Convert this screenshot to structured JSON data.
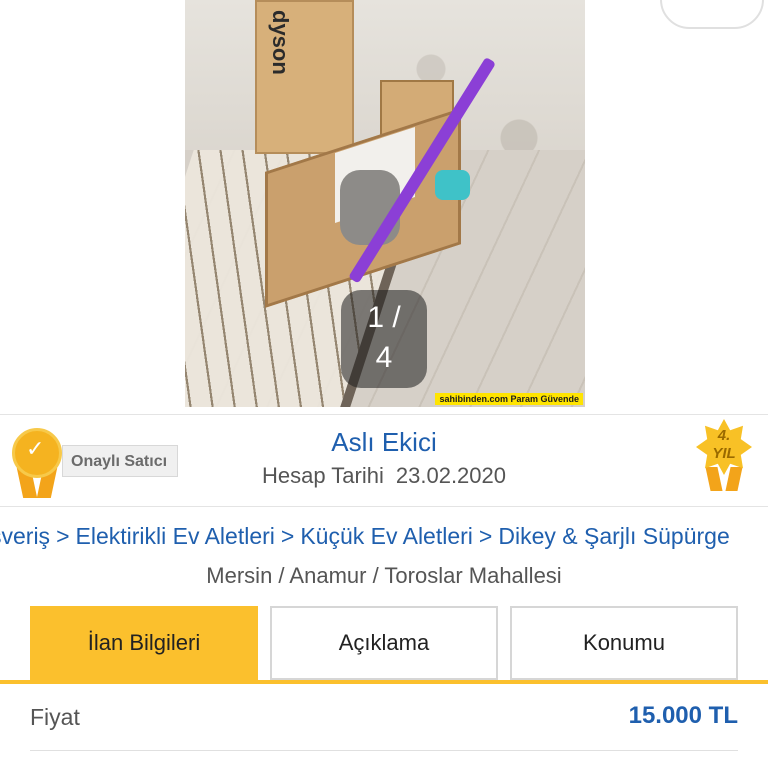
{
  "gallery": {
    "watermark": "sahibinden.com Param Güvende",
    "box_brand": "dyson",
    "counter_current": "1 /",
    "counter_total": "4"
  },
  "seller": {
    "name": "Aslı Ekici",
    "badge_label": "Onaylı Satıcı",
    "account_label": "Hesap Tarihi",
    "account_date": "23.02.2020",
    "years_badge_top": "4.",
    "years_badge_bottom": "YIL"
  },
  "breadcrumb": {
    "items": [
      "şveriş",
      "Elektirikli Ev Aletleri",
      "Küçük Ev Aletleri",
      "Dikey & Şarjlı Süpürge"
    ],
    "separator": ">"
  },
  "location": "Mersin / Anamur / Toroslar Mahallesi",
  "tabs": [
    {
      "label": "İlan Bilgileri",
      "active": true
    },
    {
      "label": "Açıklama",
      "active": false
    },
    {
      "label": "Konumu",
      "active": false
    }
  ],
  "details": {
    "price_label": "Fiyat",
    "price_value": "15.000 TL"
  },
  "colors": {
    "accent": "#fbc02d",
    "link": "#1f5fae"
  }
}
